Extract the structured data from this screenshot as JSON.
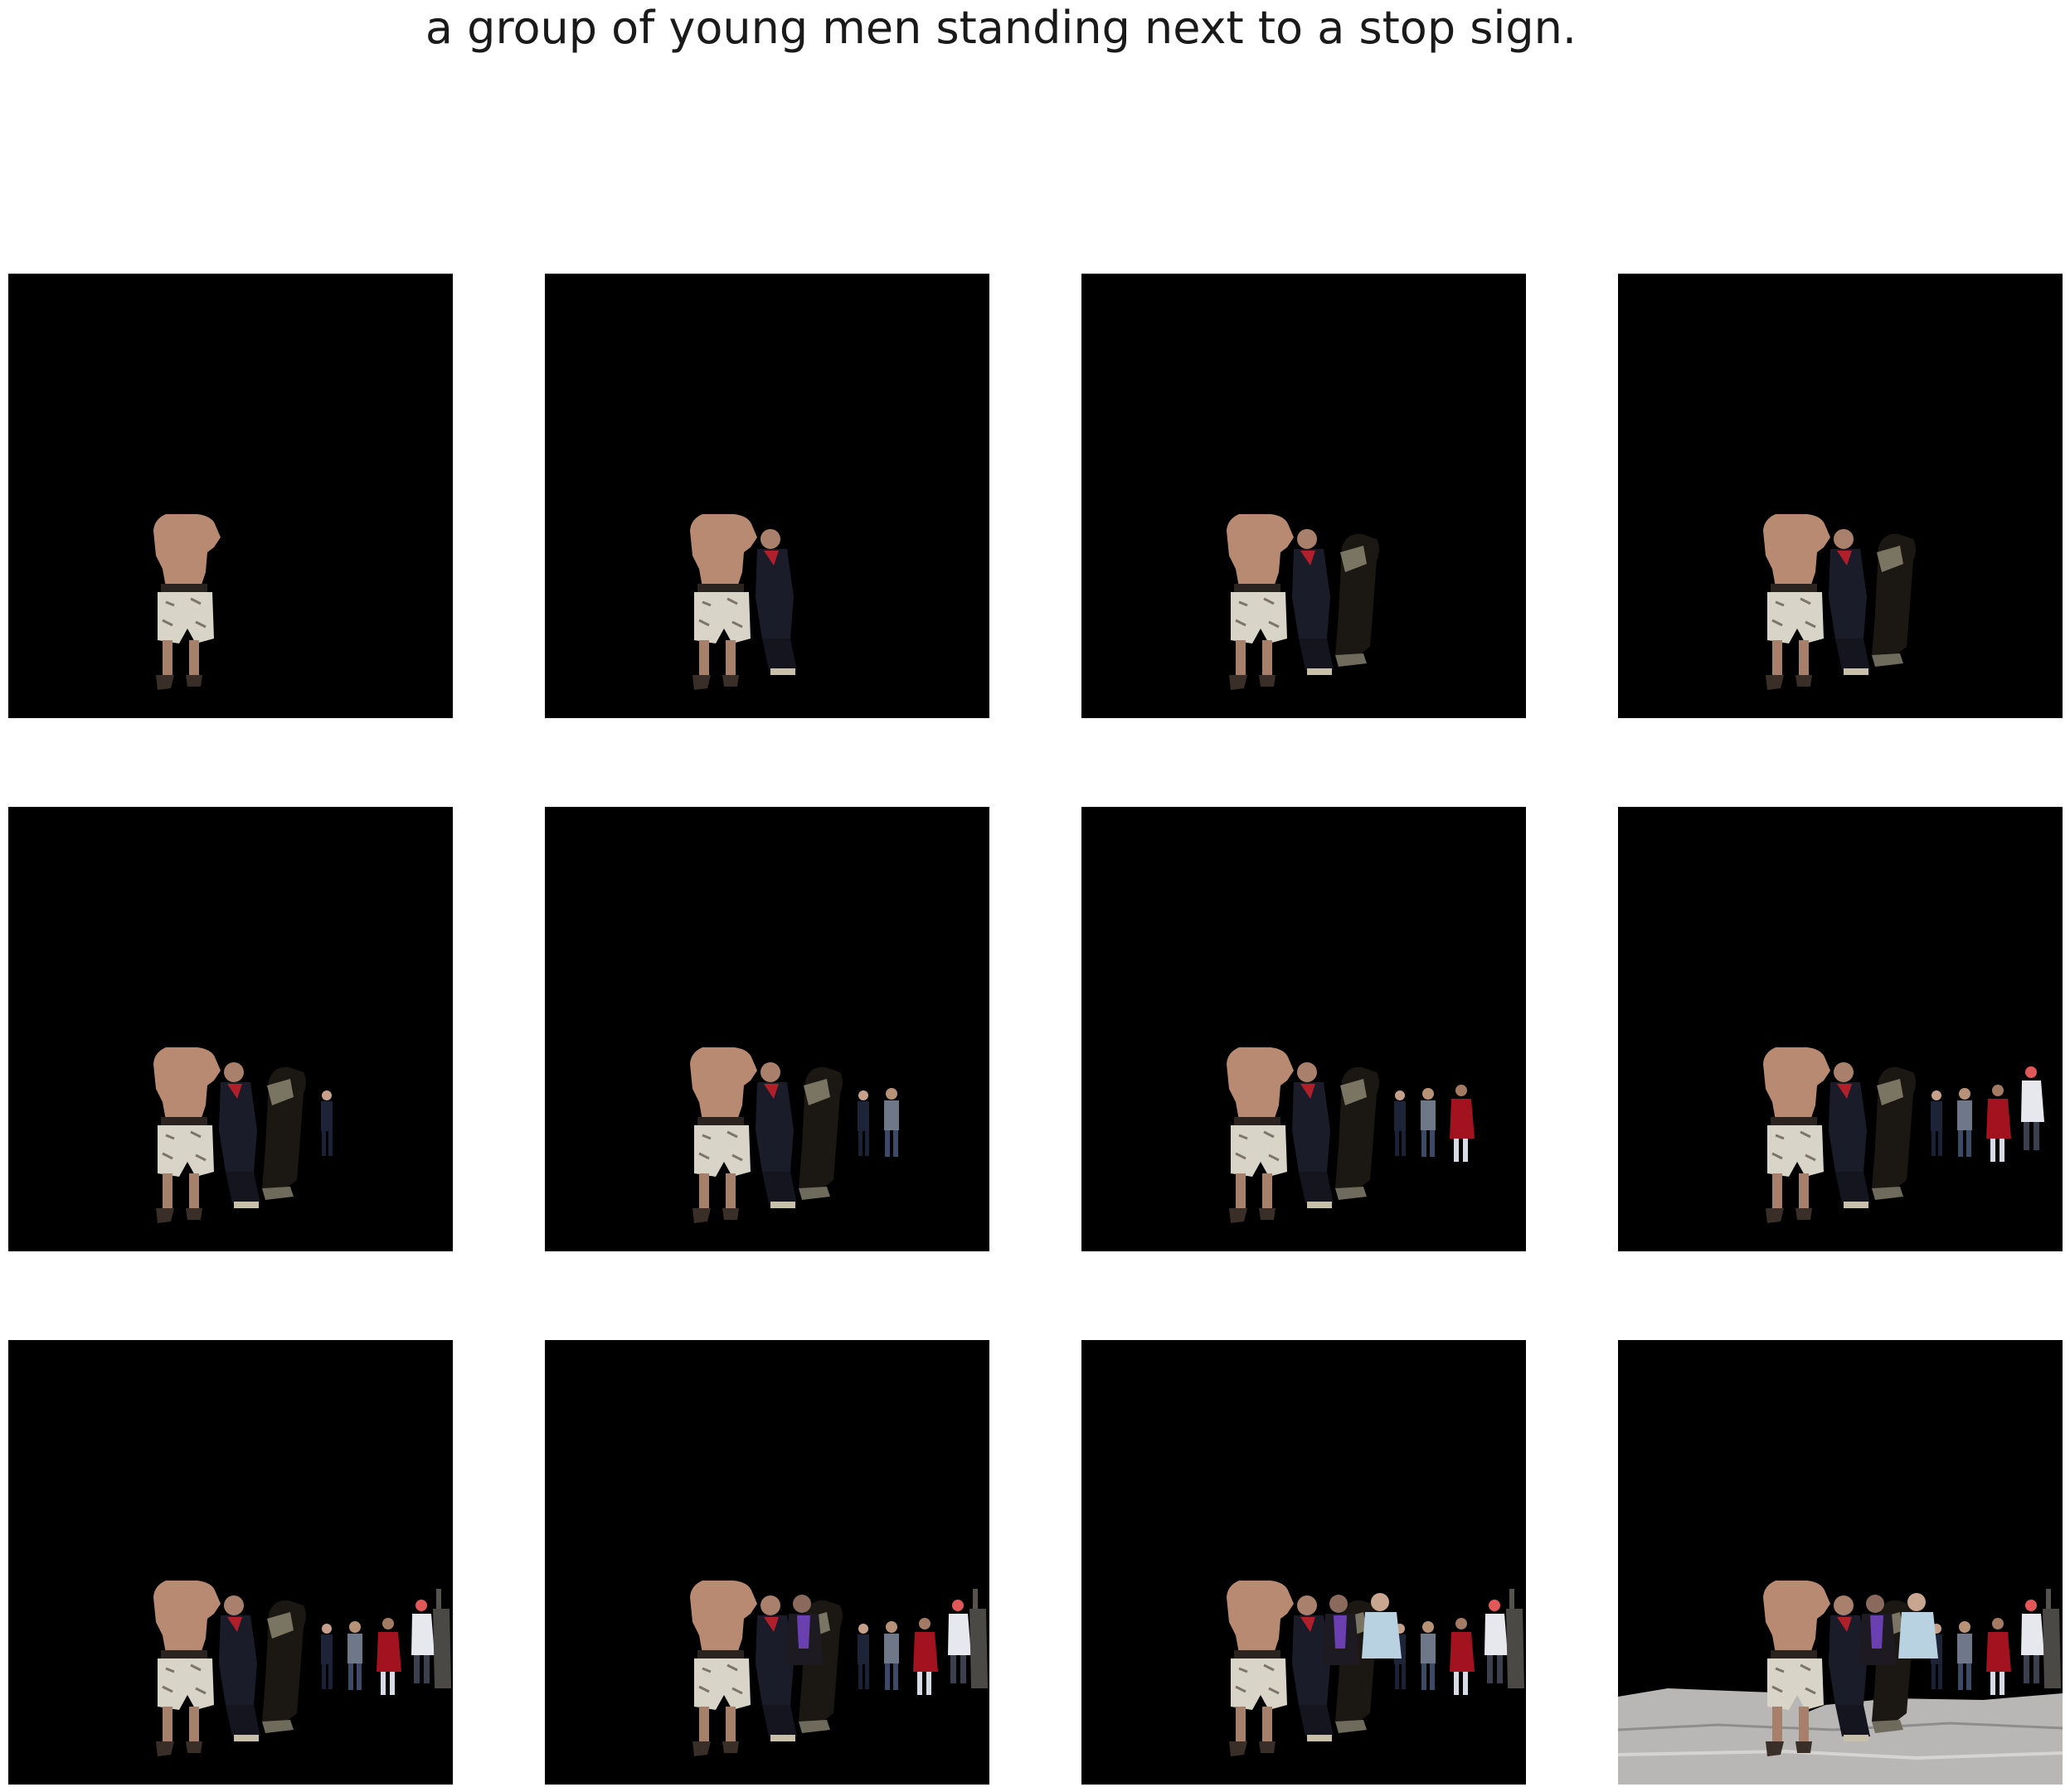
{
  "caption": "a group of young men standing next to a stop sign.",
  "grid": {
    "rows": 3,
    "columns": 4
  },
  "panels": [
    {
      "step": 1,
      "figures": [
        "shirtless-man"
      ]
    },
    {
      "step": 2,
      "figures": [
        "shirtless-man",
        "seated-woman"
      ]
    },
    {
      "step": 3,
      "figures": [
        "shirtless-man",
        "seated-woman",
        "dark-figure"
      ]
    },
    {
      "step": 4,
      "figures": [
        "shirtless-man",
        "seated-woman",
        "dark-figure"
      ]
    },
    {
      "step": 5,
      "figures": [
        "shirtless-man",
        "seated-woman",
        "dark-figure",
        "small-person-1"
      ]
    },
    {
      "step": 6,
      "figures": [
        "shirtless-man",
        "seated-woman",
        "dark-figure",
        "small-person-1",
        "small-person-2"
      ]
    },
    {
      "step": 7,
      "figures": [
        "shirtless-man",
        "seated-woman",
        "dark-figure",
        "small-person-1",
        "small-person-2",
        "red-person"
      ]
    },
    {
      "step": 8,
      "figures": [
        "shirtless-man",
        "seated-woman",
        "dark-figure",
        "small-person-1",
        "small-person-2",
        "red-person",
        "white-person"
      ]
    },
    {
      "step": 9,
      "figures": [
        "shirtless-man",
        "seated-woman",
        "dark-figure",
        "small-person-1",
        "small-person-2",
        "red-person",
        "white-person",
        "tall-figure"
      ]
    },
    {
      "step": 10,
      "figures": [
        "shirtless-man",
        "seated-woman",
        "dark-figure",
        "small-person-1",
        "small-person-2",
        "red-person",
        "white-person",
        "tall-figure",
        "purple-person"
      ]
    },
    {
      "step": 11,
      "figures": [
        "shirtless-man",
        "seated-woman",
        "dark-figure",
        "small-person-1",
        "small-person-2",
        "red-person",
        "white-person",
        "tall-figure",
        "purple-person",
        "light-blue-person"
      ]
    },
    {
      "step": 12,
      "figures": [
        "shirtless-man",
        "seated-woman",
        "dark-figure",
        "small-person-1",
        "small-person-2",
        "red-person",
        "white-person",
        "tall-figure",
        "purple-person",
        "light-blue-person",
        "ground-surface"
      ]
    }
  ],
  "colors": {
    "background": "#000000",
    "page": "#ffffff",
    "ground": "#b9b7b6"
  }
}
